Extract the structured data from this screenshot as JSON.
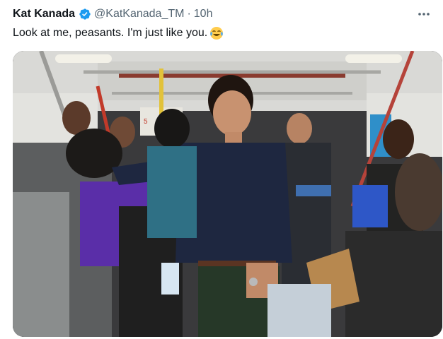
{
  "tweet": {
    "display_name": "Kat Kanada",
    "handle": "@KatKanada_TM",
    "separator": "·",
    "time": "10h",
    "text": "Look at me, peasants. I'm just like you.",
    "emoji": "face-with-tears-of-joy",
    "more_icon": "more-horizontal-icon",
    "verified_icon": "verified-badge-icon",
    "colors": {
      "verified": "#1d9bf0",
      "secondary_text": "#536471",
      "primary_text": "#0f1419"
    },
    "media": {
      "type": "photo",
      "alt": "",
      "stop_signage": [
        "5"
      ]
    }
  }
}
